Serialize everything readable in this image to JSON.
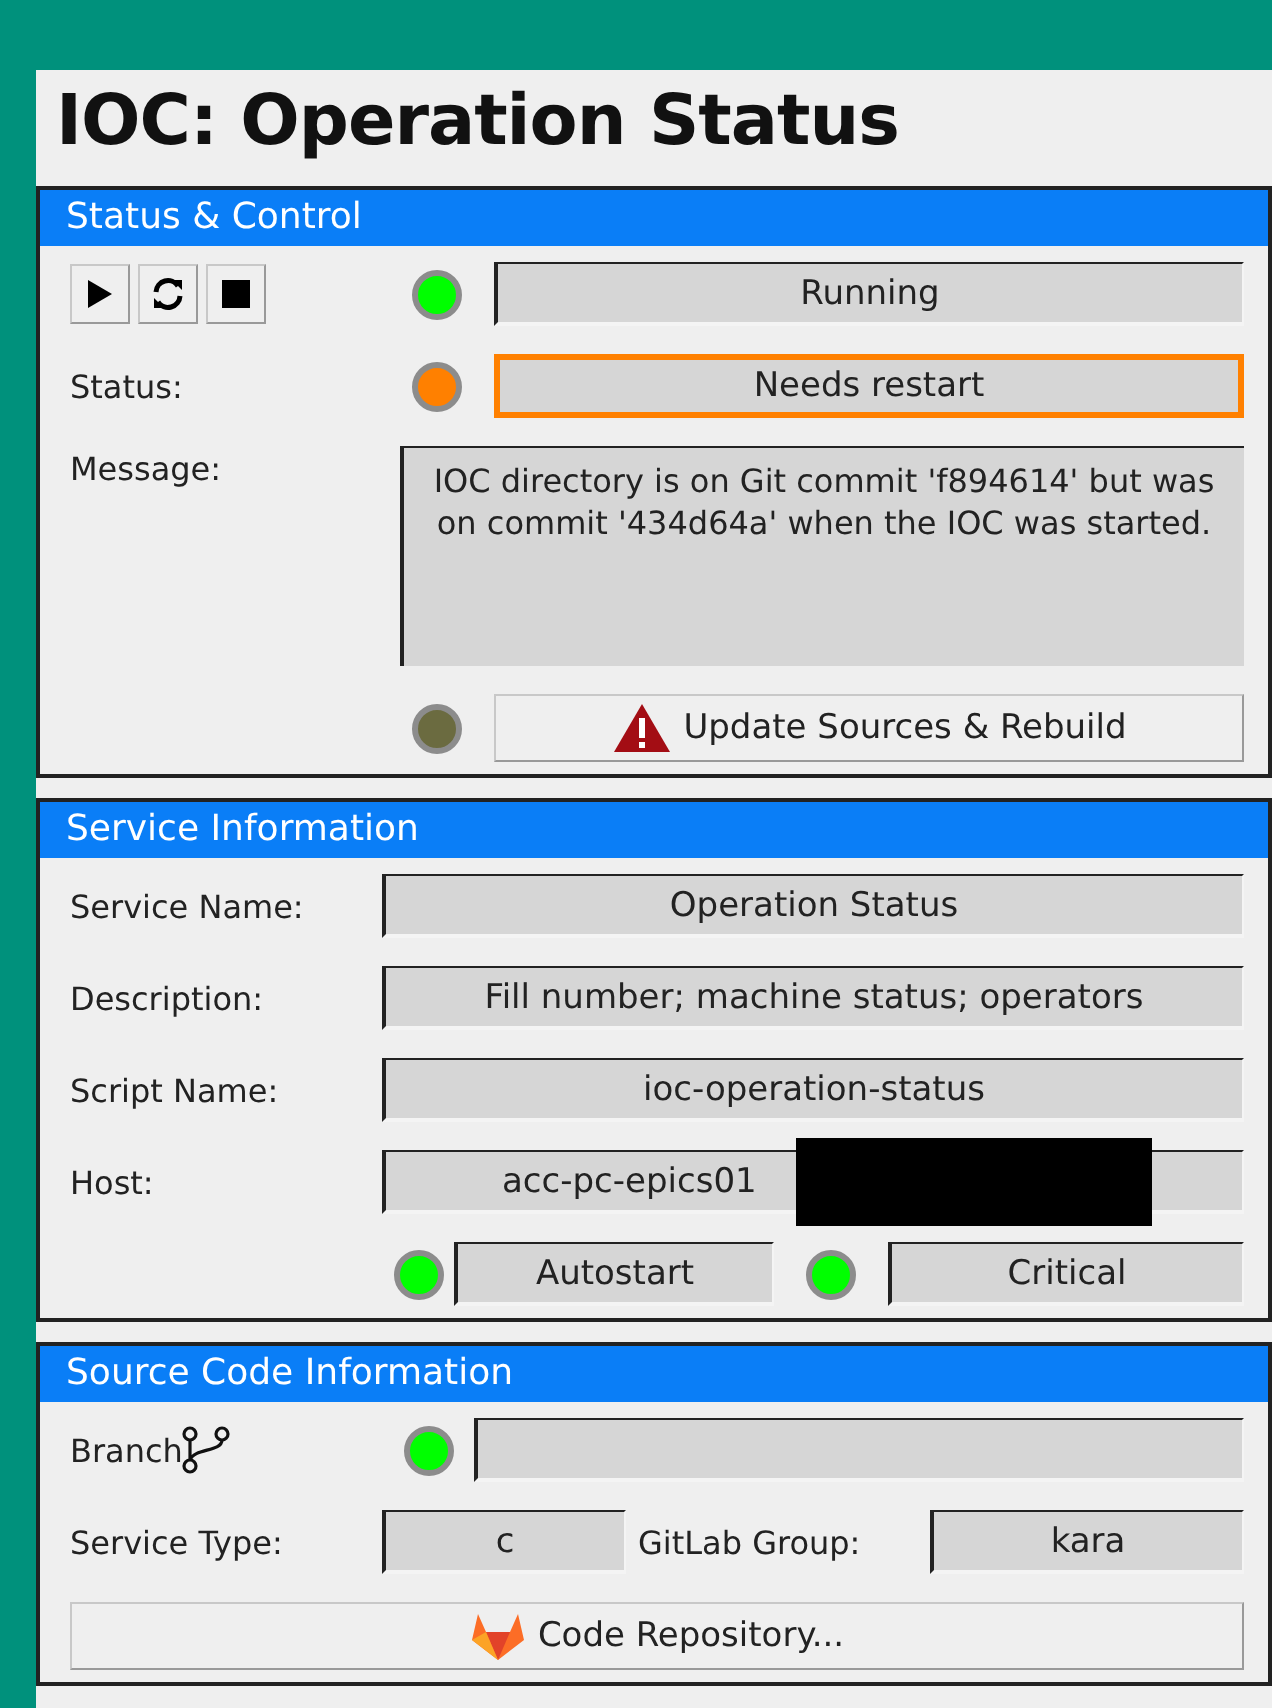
{
  "title": "IOC: Operation Status",
  "status_control": {
    "title": "Status & Control",
    "controls": [
      {
        "kind": "play"
      },
      {
        "kind": "restart"
      },
      {
        "kind": "stop"
      }
    ],
    "run_state": {
      "color": "#00ff00",
      "value": "Running"
    },
    "status": {
      "label": "Status:",
      "color": "#ff8000",
      "value": "Needs restart",
      "alert": true
    },
    "message": {
      "label": "Message:",
      "value": "IOC directory is on Git commit 'f894614' but was on commit '434d64a' when the IOC was started."
    },
    "rebuild": {
      "color": "#6b6b40",
      "label": "Update Sources & Rebuild"
    }
  },
  "service_info": {
    "title": "Service Information",
    "fields": [
      {
        "label": "Service Name:",
        "value": "Operation Status"
      },
      {
        "label": "Description:",
        "value": "Fill number; machine status; operators"
      },
      {
        "label": "Script Name:",
        "value": "ioc-operation-status"
      },
      {
        "label": "Host:",
        "value": "acc-pc-epics01",
        "redacted": true
      }
    ],
    "flags": [
      {
        "color": "#00ff00",
        "label": "Autostart"
      },
      {
        "color": "#00ff00",
        "label": "Critical"
      }
    ]
  },
  "source_code": {
    "title": "Source Code Information",
    "branch": {
      "label": "Branch",
      "color": "#00ff00"
    },
    "service_type": {
      "label": "Service Type:",
      "value": "c"
    },
    "gitlab_group": {
      "label": "GitLab Group:",
      "value": "kara"
    },
    "repository_button": "Code Repository..."
  }
}
